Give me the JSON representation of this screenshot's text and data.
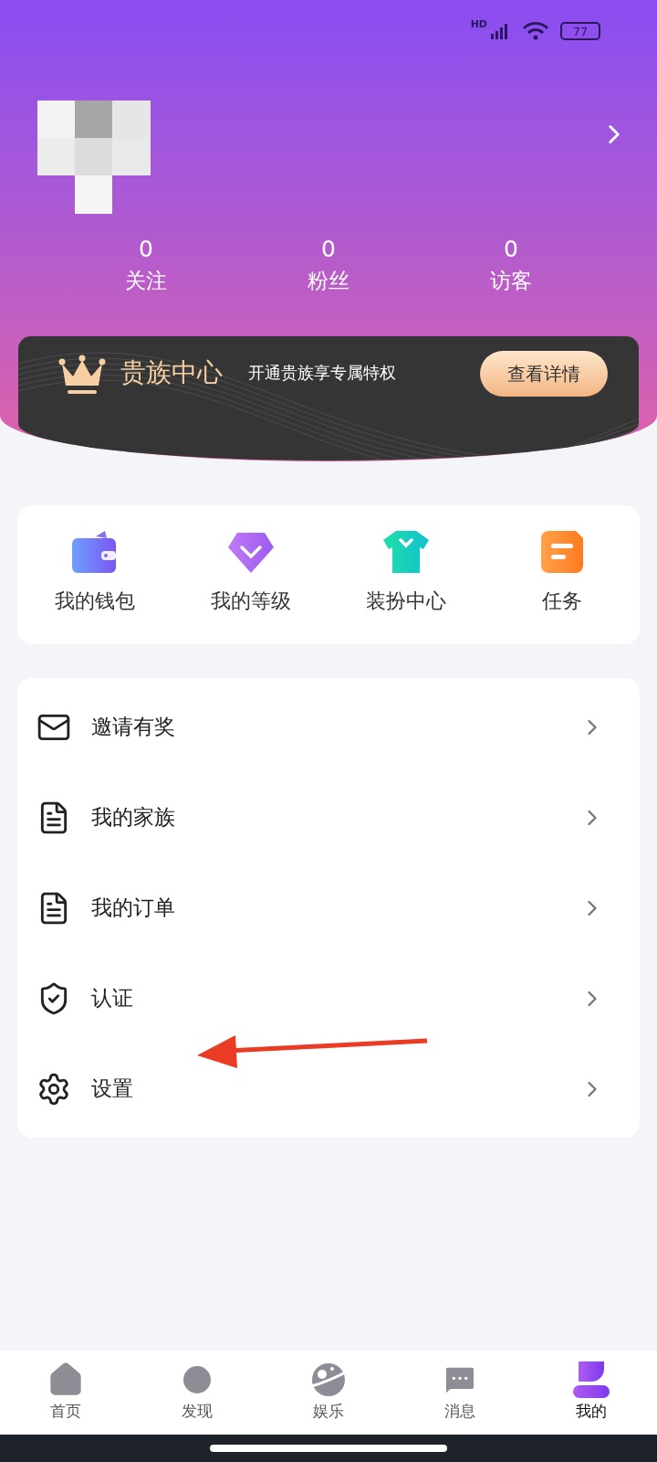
{
  "status_bar": {
    "network": "HD",
    "battery": "77"
  },
  "profile": {
    "stats": [
      {
        "count": "0",
        "label": "关注"
      },
      {
        "count": "0",
        "label": "粉丝"
      },
      {
        "count": "0",
        "label": "访客"
      }
    ]
  },
  "noble_card": {
    "title": "贵族中心",
    "subtitle": "开通贵族享专属特权",
    "button": "查看详情"
  },
  "quick_actions": [
    {
      "label": "我的钱包"
    },
    {
      "label": "我的等级"
    },
    {
      "label": "装扮中心"
    },
    {
      "label": "任务"
    }
  ],
  "menu": [
    {
      "label": "邀请有奖"
    },
    {
      "label": "我的家族"
    },
    {
      "label": "我的订单"
    },
    {
      "label": "认证"
    },
    {
      "label": "设置"
    }
  ],
  "annotation": {
    "kind": "arrow"
  },
  "tabs": [
    {
      "label": "首页",
      "selected": false
    },
    {
      "label": "发现",
      "selected": false
    },
    {
      "label": "娱乐",
      "selected": false
    },
    {
      "label": "消息",
      "selected": false
    },
    {
      "label": "我的",
      "selected": true
    }
  ]
}
